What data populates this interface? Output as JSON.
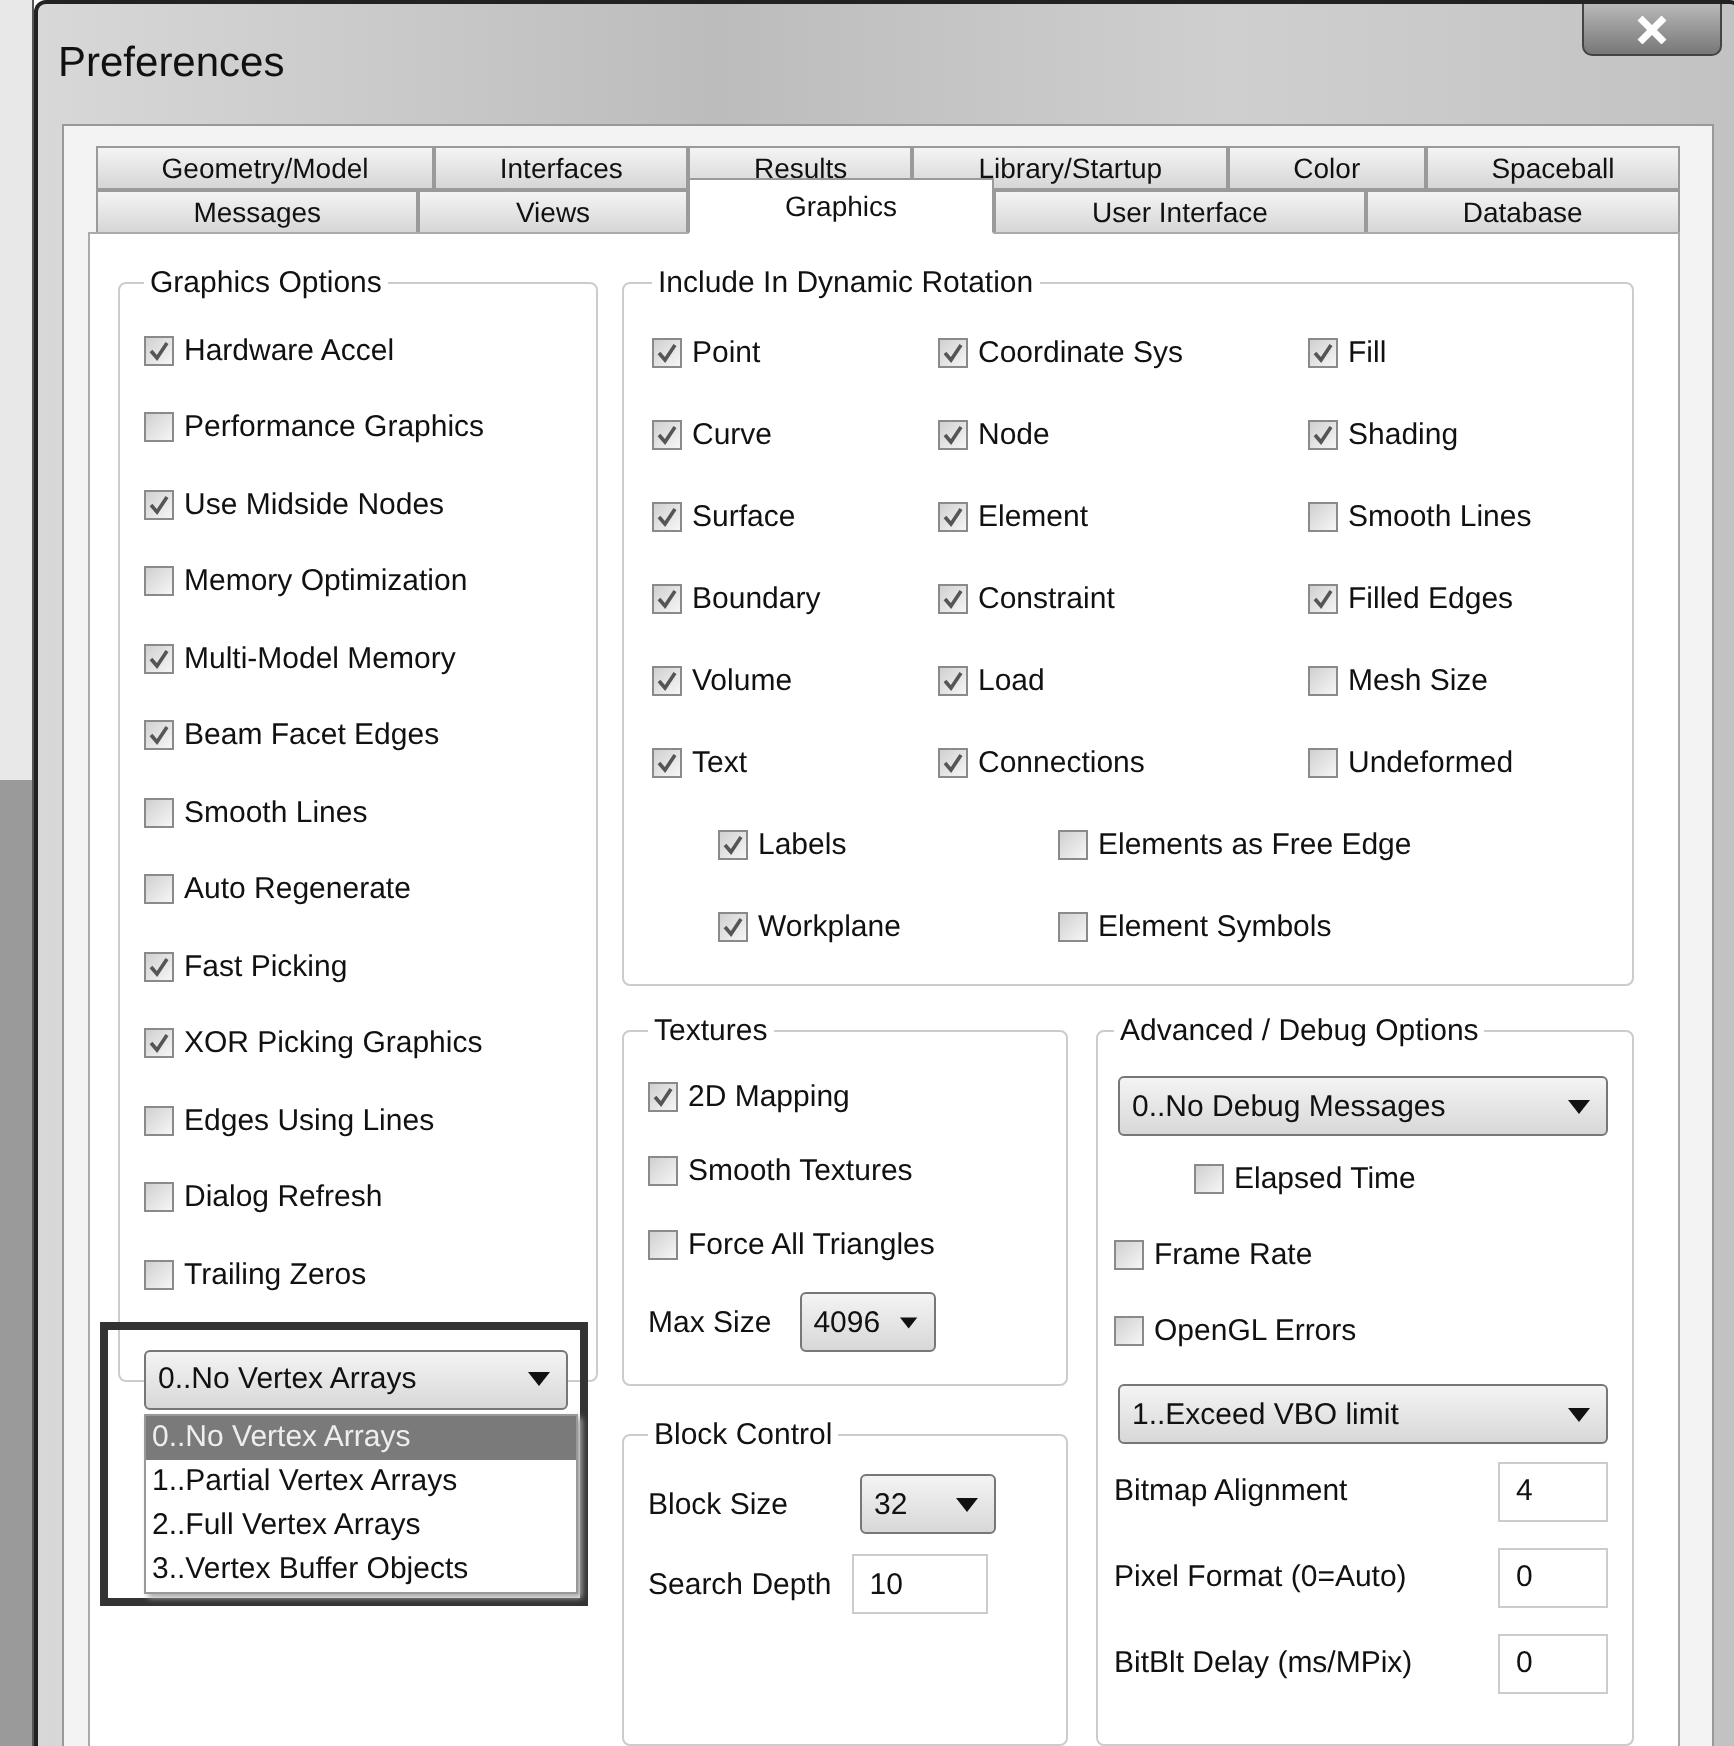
{
  "window": {
    "title": "Preferences"
  },
  "tab_rows": [
    [
      {
        "label": "Geometry/Model",
        "selected": false
      },
      {
        "label": "Interfaces",
        "selected": false
      },
      {
        "label": "Results",
        "selected": false
      },
      {
        "label": "Library/Startup",
        "selected": false
      },
      {
        "label": "Color",
        "selected": false
      },
      {
        "label": "Spaceball",
        "selected": false
      }
    ],
    [
      {
        "label": "Messages",
        "selected": false
      },
      {
        "label": "Views",
        "selected": false
      },
      {
        "label": "Graphics",
        "selected": true
      },
      {
        "label": "User Interface",
        "selected": false
      },
      {
        "label": "Database",
        "selected": false
      }
    ]
  ],
  "graphics_options": {
    "title": "Graphics Options",
    "checkboxes": [
      {
        "label": "Hardware Accel",
        "checked": true
      },
      {
        "label": "Performance Graphics",
        "checked": false
      },
      {
        "label": "Use Midside Nodes",
        "checked": true
      },
      {
        "label": "Memory Optimization",
        "checked": false
      },
      {
        "label": "Multi-Model Memory",
        "checked": true
      },
      {
        "label": "Beam Facet Edges",
        "checked": true
      },
      {
        "label": "Smooth Lines",
        "checked": false
      },
      {
        "label": "Auto Regenerate",
        "checked": false
      },
      {
        "label": "Fast Picking",
        "checked": true
      },
      {
        "label": "XOR Picking Graphics",
        "checked": true
      },
      {
        "label": "Edges Using Lines",
        "checked": false
      },
      {
        "label": "Dialog Refresh",
        "checked": false
      },
      {
        "label": "Trailing Zeros",
        "checked": false
      }
    ],
    "vertex_dropdown": {
      "value": "0..No Vertex Arrays",
      "options": [
        {
          "label": "0..No Vertex Arrays",
          "selected": true
        },
        {
          "label": "1..Partial Vertex Arrays",
          "selected": false
        },
        {
          "label": "2..Full Vertex Arrays",
          "selected": false
        },
        {
          "label": "3..Vertex Buffer Objects",
          "selected": false
        }
      ]
    }
  },
  "dynamic_rotation": {
    "title": "Include In Dynamic Rotation",
    "items": [
      {
        "label": "Point",
        "checked": true
      },
      {
        "label": "Coordinate Sys",
        "checked": true
      },
      {
        "label": "Fill",
        "checked": true
      },
      {
        "label": "Curve",
        "checked": true
      },
      {
        "label": "Node",
        "checked": true
      },
      {
        "label": "Shading",
        "checked": true
      },
      {
        "label": "Surface",
        "checked": true
      },
      {
        "label": "Element",
        "checked": true
      },
      {
        "label": "Smooth Lines",
        "checked": false
      },
      {
        "label": "Boundary",
        "checked": true
      },
      {
        "label": "Constraint",
        "checked": true
      },
      {
        "label": "Filled Edges",
        "checked": true
      },
      {
        "label": "Volume",
        "checked": true
      },
      {
        "label": "Load",
        "checked": true
      },
      {
        "label": "Mesh Size",
        "checked": false
      },
      {
        "label": "Text",
        "checked": true
      },
      {
        "label": "Connections",
        "checked": true
      },
      {
        "label": "Undeformed",
        "checked": false
      }
    ],
    "sub_items": [
      {
        "label": "Labels",
        "checked": true
      },
      {
        "label": "Elements as Free Edge",
        "checked": false
      },
      {
        "label": "Workplane",
        "checked": true
      },
      {
        "label": "Element Symbols",
        "checked": false
      }
    ]
  },
  "textures": {
    "title": "Textures",
    "checkboxes": [
      {
        "label": "2D Mapping",
        "checked": true
      },
      {
        "label": "Smooth Textures",
        "checked": false
      },
      {
        "label": "Force All Triangles",
        "checked": false
      }
    ],
    "max_size": {
      "label": "Max Size",
      "value": "4096"
    }
  },
  "block_control": {
    "title": "Block Control",
    "block_size": {
      "label": "Block Size",
      "value": "32"
    },
    "search_depth": {
      "label": "Search Depth",
      "value": "10"
    }
  },
  "advanced": {
    "title": "Advanced / Debug Options",
    "debug_dropdown": {
      "value": "0..No Debug Messages"
    },
    "elapsed_time": {
      "label": "Elapsed Time",
      "checked": false
    },
    "checkboxes": [
      {
        "label": "Frame Rate",
        "checked": false
      },
      {
        "label": "OpenGL Errors",
        "checked": false
      }
    ],
    "vbo_dropdown": {
      "value": "1..Exceed VBO limit"
    },
    "fields": [
      {
        "label": "Bitmap Alignment",
        "value": "4"
      },
      {
        "label": "Pixel Format (0=Auto)",
        "value": "0"
      },
      {
        "label": "BitBlt Delay (ms/MPix)",
        "value": "0"
      }
    ]
  }
}
